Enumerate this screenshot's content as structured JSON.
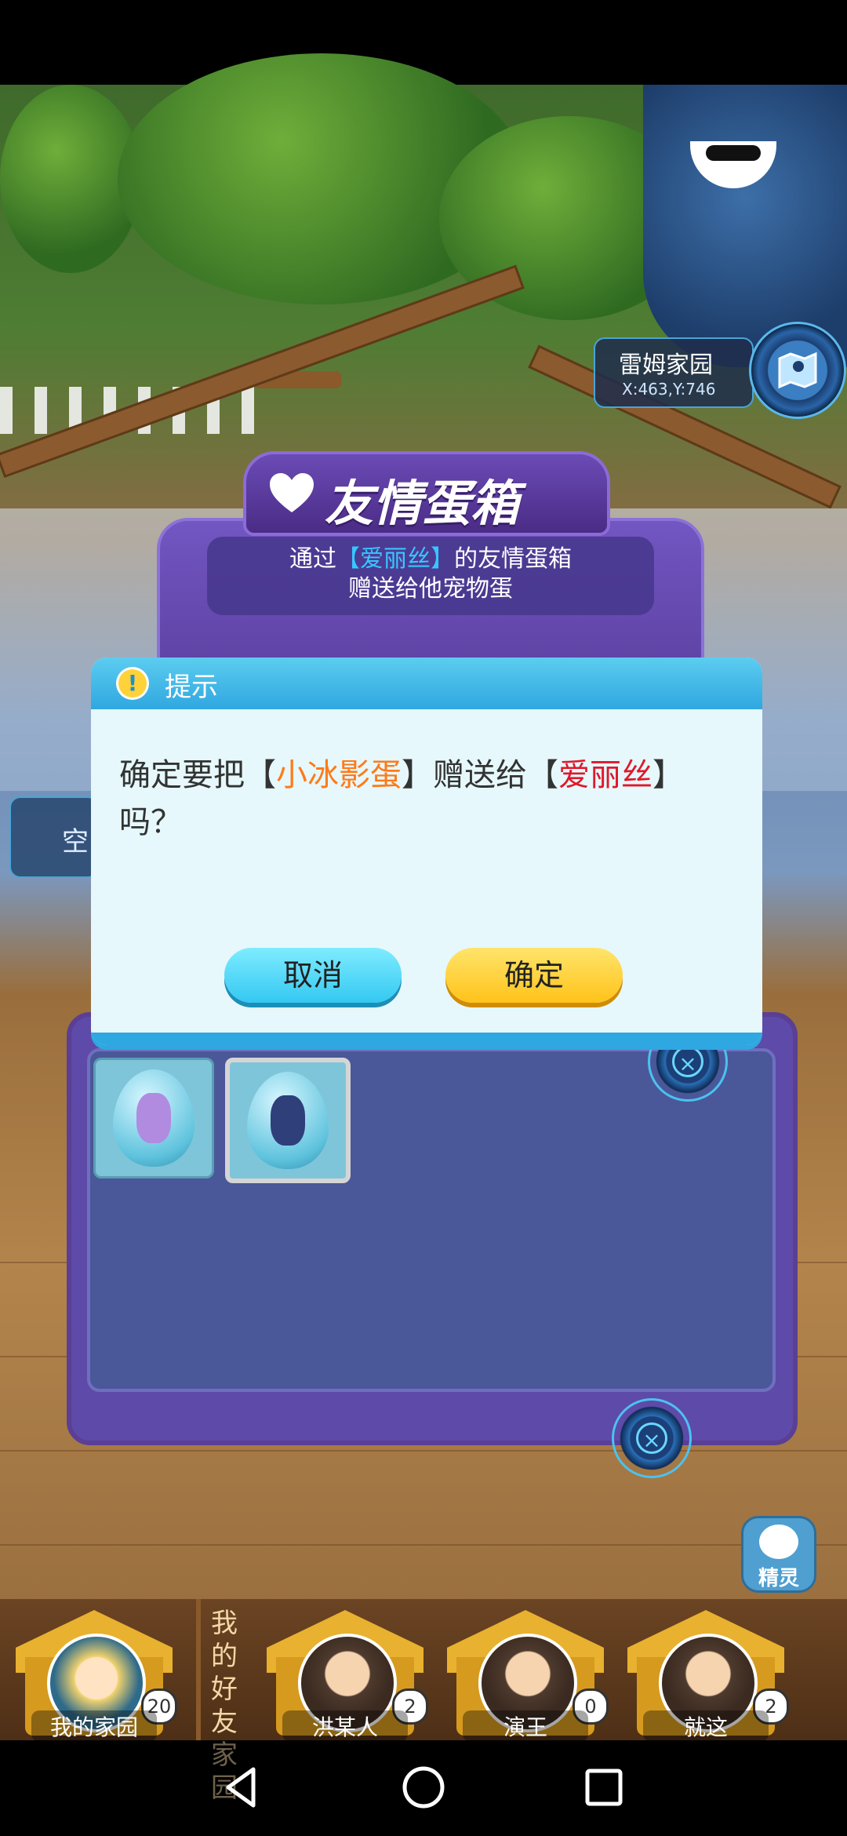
{
  "scene": {
    "home_name": "雷姆家园",
    "coordinates": "X:463,Y:746",
    "empty_tag": "空"
  },
  "eggbox": {
    "title": "友情蛋箱",
    "desc_prefix": "通过",
    "desc_name": "【爱丽丝】",
    "desc_suffix": "的友情蛋箱",
    "desc_line2": "赠送给他宠物蛋",
    "eggs": [
      {
        "name": "egg-slot-1",
        "selected": false
      },
      {
        "name": "egg-slot-2",
        "selected": true
      }
    ]
  },
  "dialog": {
    "title": "提示",
    "msg_prefix": "确定要把【",
    "item": "小冰影蛋",
    "msg_mid": "】赠送给【",
    "person": "爱丽丝",
    "msg_suffix": "】",
    "msg_line2": "吗？",
    "cancel_label": "取消",
    "confirm_label": "确定"
  },
  "sprite_button": {
    "label": "精灵"
  },
  "friends_bar": {
    "heading": "我的好友家园",
    "my_home": {
      "label": "我的家园",
      "count": "20"
    },
    "friends": [
      {
        "name": "洪某人",
        "count": "2"
      },
      {
        "name": "演王",
        "count": "0"
      },
      {
        "name": "就这",
        "count": "2"
      }
    ]
  },
  "colors": {
    "dialog_header": "#2fa7e0",
    "item_highlight": "#ff7a1a",
    "person_highlight": "#e0182a",
    "cancel_button": "#34c8f2",
    "confirm_button": "#ffc31a"
  }
}
